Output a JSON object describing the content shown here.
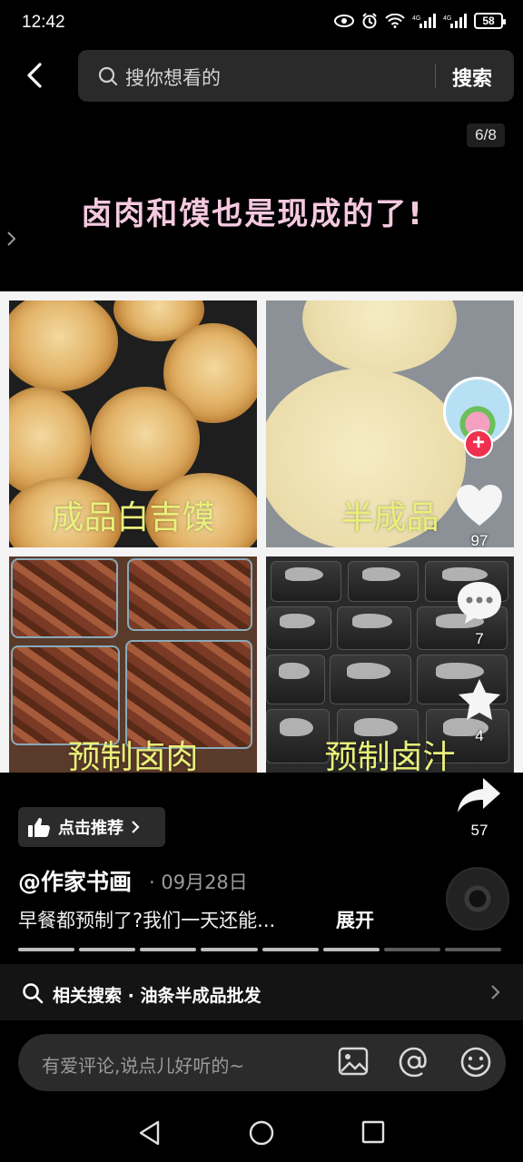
{
  "status_bar": {
    "time": "12:42",
    "battery": "58"
  },
  "search": {
    "placeholder": "搜你想看的",
    "submit": "搜索"
  },
  "viewer": {
    "page_indicator": "6/8",
    "banner_title": "卤肉和馍也是现成的了!",
    "photos": [
      {
        "caption": "成品白吉馍"
      },
      {
        "caption": "半成品"
      },
      {
        "caption": "预制卤肉"
      },
      {
        "caption": "预制卤汁"
      }
    ]
  },
  "actions": {
    "likes": "97",
    "comments": "7",
    "favorites": "4",
    "shares": "57"
  },
  "post": {
    "recommend": "点击推荐",
    "author": "@作家书画",
    "date": "· 09月28日",
    "caption": "早餐都预制了?我们一天还能...",
    "expand": "展开",
    "progress": {
      "current": 6,
      "total": 8
    }
  },
  "related": {
    "label": "相关搜索 · 油条半成品批发"
  },
  "comment": {
    "placeholder": "有爱评论,说点儿好听的~"
  },
  "colors": {
    "follow": "#f0304f",
    "banner_text": "#f4c9df",
    "caption_text": "#e9f07a"
  }
}
